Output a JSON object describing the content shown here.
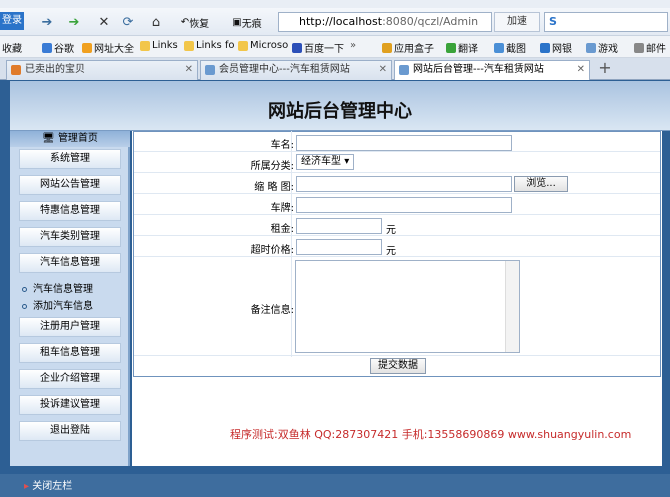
{
  "browser": {
    "login_label": "登录",
    "back_icon": "back-arrow-icon",
    "forward_icon": "forward-arrow-icon",
    "restore_label": "恢复",
    "traceless_label": "无痕",
    "address_host": "http://localhost",
    "address_rest": ":8080/qczl/Admin",
    "accelerate_label": "加速"
  },
  "bookmarks": {
    "favorites": "收藏",
    "items": [
      "谷歌",
      "网址大全",
      "Links",
      "Links fo",
      "Microso",
      "百度一下"
    ],
    "more": "»",
    "right_items": [
      "应用盒子",
      "翻译",
      "截图",
      "网银",
      "游戏",
      "邮件"
    ]
  },
  "tabs": [
    {
      "label": "已卖出的宝贝"
    },
    {
      "label": "会员管理中心---汽车租赁网站"
    },
    {
      "label": "网站后台管理---汽车租赁网站"
    }
  ],
  "page": {
    "title": "网站后台管理中心",
    "sidebar_header": "管理首页",
    "menu": [
      "系统管理",
      "网站公告管理",
      "特惠信息管理",
      "汽车类别管理",
      "汽车信息管理"
    ],
    "submenu": [
      "汽车信息管理",
      "添加汽车信息"
    ],
    "menu2": [
      "注册用户管理",
      "租车信息管理",
      "企业介绍管理",
      "投诉建议管理",
      "退出登陆"
    ],
    "form": {
      "car_name_label": "车名:",
      "category_label": "所属分类:",
      "category_value": "经济车型",
      "thumb_label": "缩 略 图:",
      "browse_label": "浏览...",
      "plate_label": "车牌:",
      "rent_label": "租金:",
      "unit": "元",
      "overtime_label": "超时价格:",
      "notes_label": "备注信息:",
      "submit_label": "提交数据"
    },
    "credit": "程序测试:双鱼林 QQ:287307421 手机:13558690869 www.shuangyulin.com",
    "close_sidebar": "关闭左栏"
  }
}
